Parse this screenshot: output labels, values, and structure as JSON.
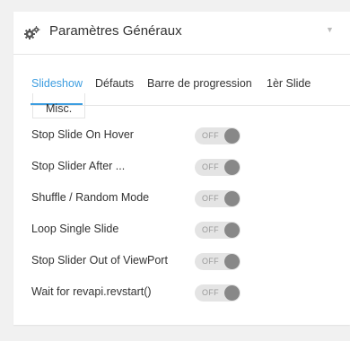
{
  "panel": {
    "title": "Paramètres Généraux",
    "header_icon": "gears-icon",
    "collapse_icon": "triangle-down-icon"
  },
  "tabs": [
    {
      "label": "Slideshow",
      "active": true
    },
    {
      "label": "Défauts",
      "active": false
    },
    {
      "label": "Barre de progression",
      "active": false
    },
    {
      "label": "1èr Slide",
      "active": false
    },
    {
      "label": "Misc.",
      "active": false
    }
  ],
  "settings": [
    {
      "label": "Stop Slide On Hover",
      "state": "OFF"
    },
    {
      "label": "Stop Slider After ...",
      "state": "OFF"
    },
    {
      "label": "Shuffle / Random Mode",
      "state": "OFF"
    },
    {
      "label": "Loop Single Slide",
      "state": "OFF"
    },
    {
      "label": "Stop Slider Out of ViewPort",
      "state": "OFF"
    },
    {
      "label": "Wait for revapi.revstart()",
      "state": "OFF"
    }
  ],
  "colors": {
    "accent": "#3c9de0",
    "toggle_track": "#e4e4e4",
    "toggle_knob": "#888888",
    "page_background": "#f1f1f1"
  }
}
